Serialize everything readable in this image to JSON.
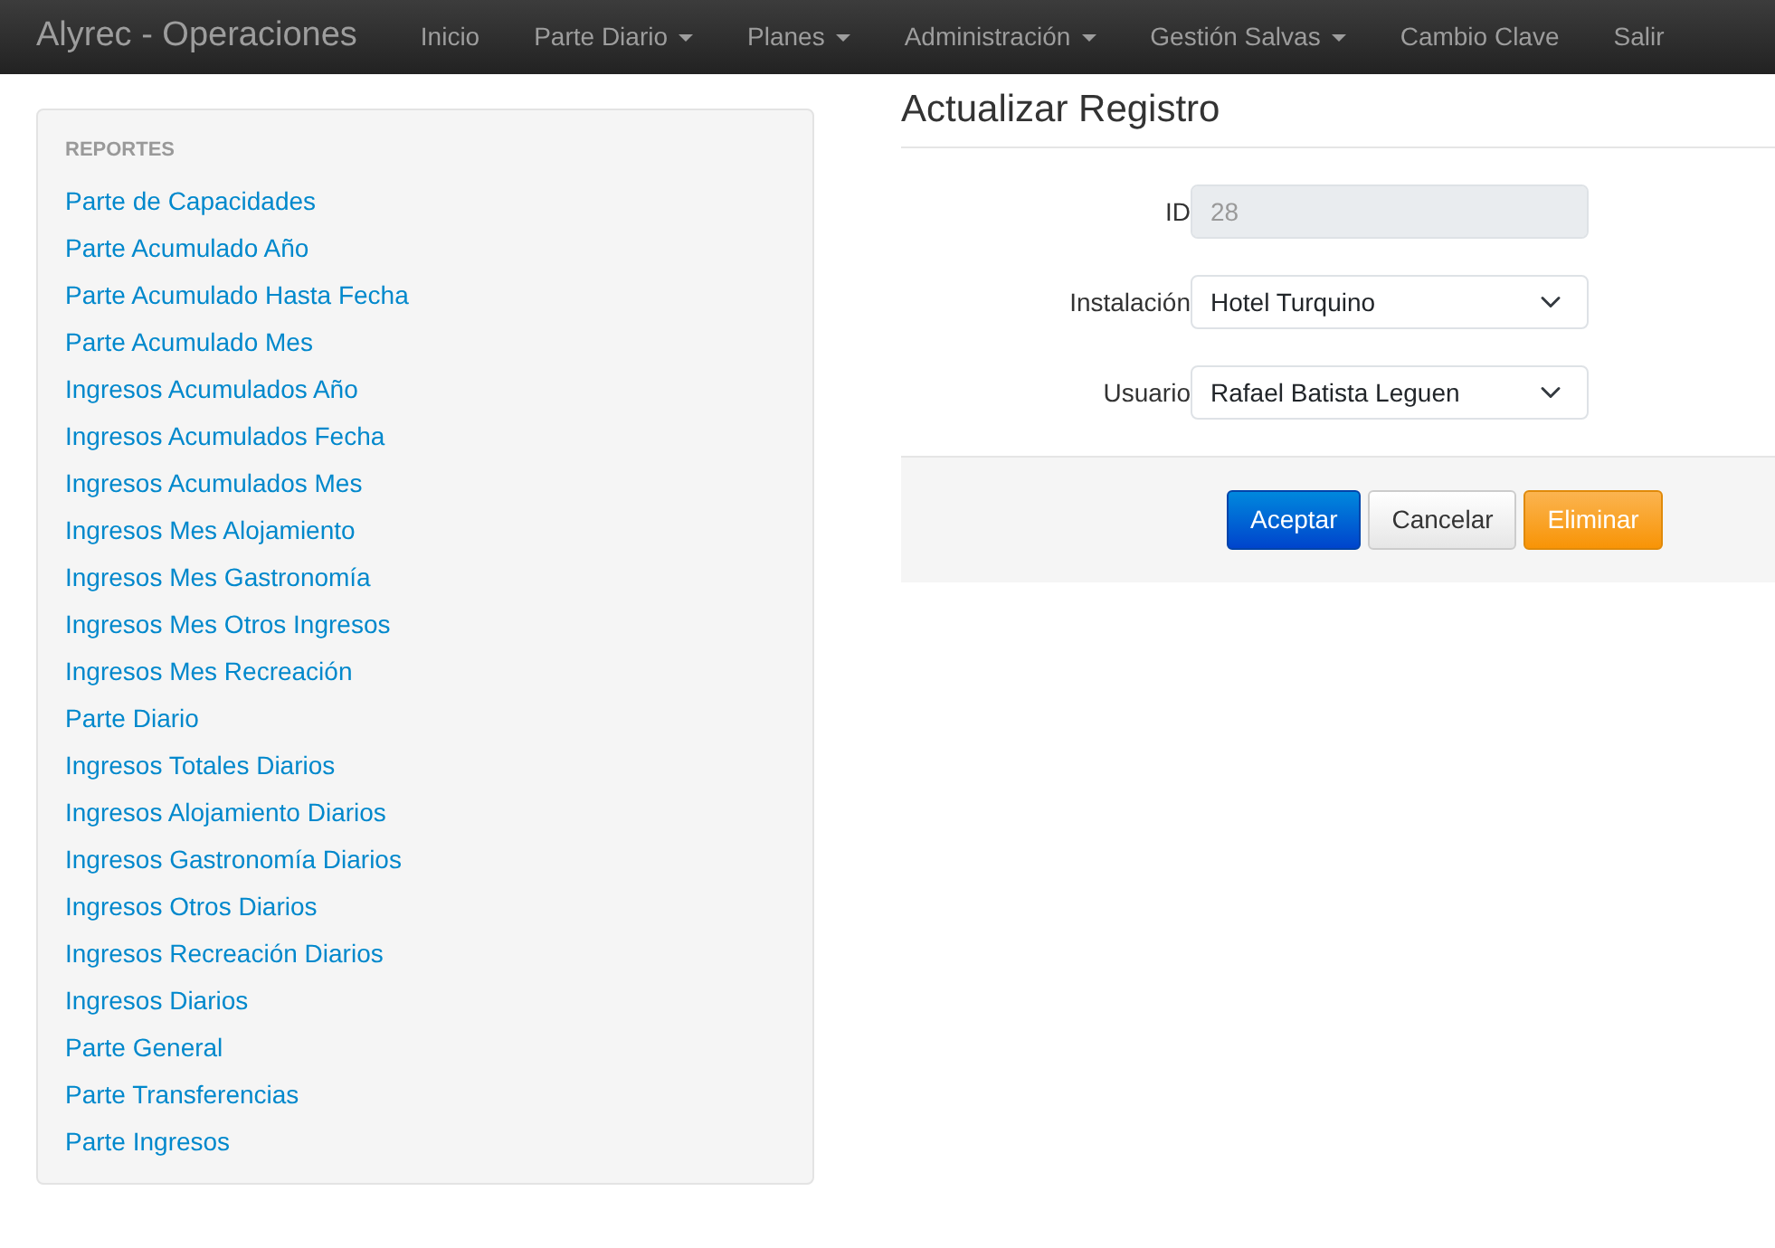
{
  "navbar": {
    "brand": "Alyrec - Operaciones",
    "items": [
      {
        "label": "Inicio",
        "kind": "link"
      },
      {
        "label": "Parte Diario",
        "kind": "dropdown"
      },
      {
        "label": "Planes",
        "kind": "dropdown"
      },
      {
        "label": "Administración",
        "kind": "dropdown"
      },
      {
        "label": "Gestión Salvas",
        "kind": "dropdown"
      },
      {
        "label": "Cambio Clave",
        "kind": "link"
      },
      {
        "label": "Salir",
        "kind": "link"
      }
    ]
  },
  "sidebar": {
    "heading": "REPORTES",
    "items": [
      "Parte de Capacidades",
      "Parte Acumulado Año",
      "Parte Acumulado Hasta Fecha",
      "Parte Acumulado Mes",
      "Ingresos Acumulados Año",
      "Ingresos Acumulados Fecha",
      "Ingresos Acumulados Mes",
      "Ingresos Mes Alojamiento",
      "Ingresos Mes Gastronomía",
      "Ingresos Mes Otros Ingresos",
      "Ingresos Mes Recreación",
      "Parte Diario",
      "Ingresos Totales Diarios",
      "Ingresos Alojamiento Diarios",
      "Ingresos Gastronomía Diarios",
      "Ingresos Otros Diarios",
      "Ingresos Recreación Diarios",
      "Ingresos Diarios",
      "Parte General",
      "Parte Transferencias",
      "Parte Ingresos"
    ]
  },
  "form": {
    "title": "Actualizar Registro",
    "fields": [
      {
        "label": "ID",
        "kind": "text",
        "value": "28",
        "disabled": true
      },
      {
        "label": "Instalación",
        "kind": "select",
        "value": "Hotel Turquino",
        "disabled": false
      },
      {
        "label": "Usuario",
        "kind": "select",
        "value": "Rafael Batista Leguen",
        "disabled": false
      }
    ],
    "buttons": [
      {
        "label": "Aceptar",
        "kind": "primary"
      },
      {
        "label": "Cancelar",
        "kind": "default"
      },
      {
        "label": "Eliminar",
        "kind": "warning"
      }
    ]
  }
}
